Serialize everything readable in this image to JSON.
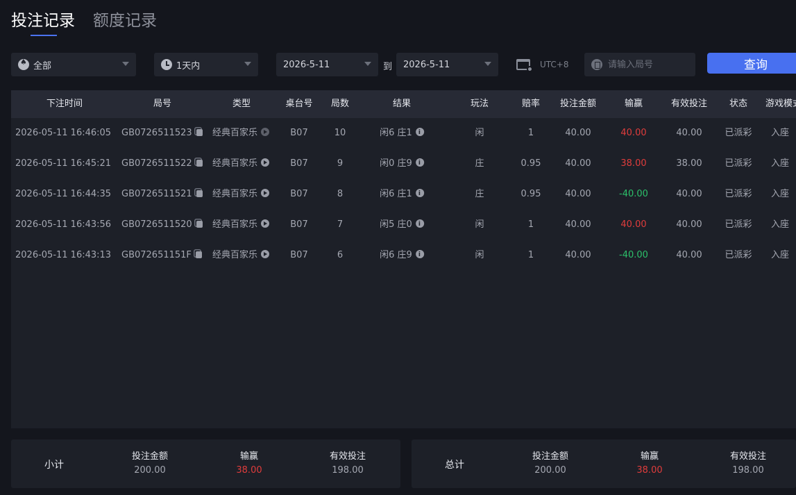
{
  "tabs": [
    {
      "label": "投注记录",
      "active": true
    },
    {
      "label": "额度记录",
      "active": false
    }
  ],
  "filters": {
    "game_type": "全部",
    "time_range": "1天内",
    "date_from": "2026-5-11",
    "to_label": "到",
    "date_to": "2026-5-11",
    "timezone": "UTC+8",
    "round_placeholder": "请输入局号",
    "round_value": "",
    "query_label": "查询"
  },
  "table": {
    "headers": [
      "下注时间",
      "局号",
      "类型",
      "桌台号",
      "局数",
      "结果",
      "玩法",
      "赔率",
      "投注金额",
      "输赢",
      "有效投注",
      "状态",
      "游戏模式"
    ],
    "rows": [
      {
        "time": "2026-05-11 16:46:05",
        "round_id": "GB0726511523",
        "type": "经典百家乐",
        "table": "B07",
        "round": "10",
        "result": "闲6 庄1",
        "bet": "闲",
        "odds": "1",
        "amount": "40.00",
        "winloss": "40.00",
        "winloss_sign": "pos",
        "valid": "40.00",
        "status": "已派彩",
        "mode": "入座"
      },
      {
        "time": "2026-05-11 16:45:21",
        "round_id": "GB0726511522",
        "type": "经典百家乐",
        "table": "B07",
        "round": "9",
        "result": "闲0 庄9",
        "bet": "庄",
        "odds": "0.95",
        "amount": "40.00",
        "winloss": "38.00",
        "winloss_sign": "pos",
        "valid": "38.00",
        "status": "已派彩",
        "mode": "入座"
      },
      {
        "time": "2026-05-11 16:44:35",
        "round_id": "GB0726511521",
        "type": "经典百家乐",
        "table": "B07",
        "round": "8",
        "result": "闲6 庄1",
        "bet": "庄",
        "odds": "0.95",
        "amount": "40.00",
        "winloss": "-40.00",
        "winloss_sign": "neg",
        "valid": "40.00",
        "status": "已派彩",
        "mode": "入座"
      },
      {
        "time": "2026-05-11 16:43:56",
        "round_id": "GB0726511520",
        "type": "经典百家乐",
        "table": "B07",
        "round": "7",
        "result": "闲5 庄0",
        "bet": "闲",
        "odds": "1",
        "amount": "40.00",
        "winloss": "40.00",
        "winloss_sign": "pos",
        "valid": "40.00",
        "status": "已派彩",
        "mode": "入座"
      },
      {
        "time": "2026-05-11 16:43:13",
        "round_id": "GB072651151F",
        "type": "经典百家乐",
        "table": "B07",
        "round": "6",
        "result": "闲6 庄9",
        "bet": "闲",
        "odds": "1",
        "amount": "40.00",
        "winloss": "-40.00",
        "winloss_sign": "neg",
        "valid": "40.00",
        "status": "已派彩",
        "mode": "入座"
      }
    ]
  },
  "subtotal": {
    "label": "小计",
    "amount_label": "投注金额",
    "amount": "200.00",
    "winloss_label": "输赢",
    "winloss": "38.00",
    "valid_label": "有效投注",
    "valid": "198.00"
  },
  "total": {
    "label": "总计",
    "amount_label": "投注金额",
    "amount": "200.00",
    "winloss_label": "输赢",
    "winloss": "38.00",
    "valid_label": "有效投注",
    "valid": "198.00"
  },
  "colors": {
    "accent": "#4870f0",
    "win": "#e03c3c",
    "loss": "#2cc06a"
  }
}
